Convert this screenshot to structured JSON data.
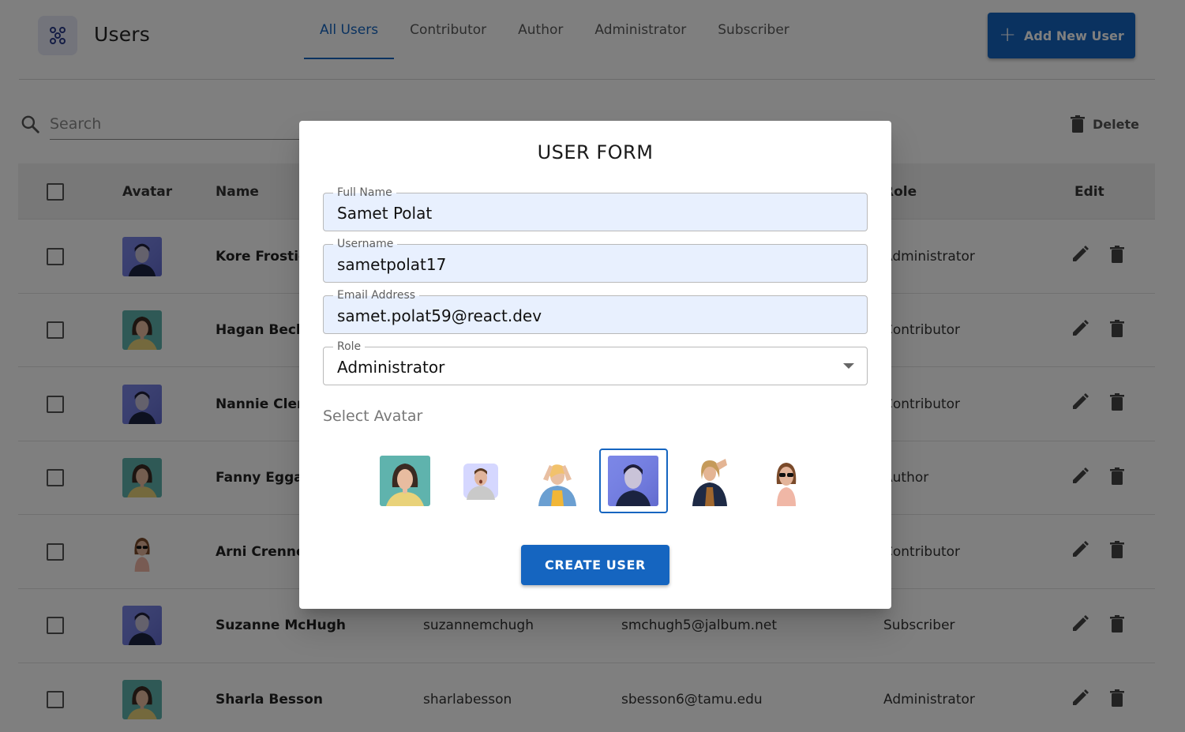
{
  "header": {
    "title": "Users",
    "tabs": [
      {
        "label": "All Users",
        "active": true
      },
      {
        "label": "Contributor",
        "active": false
      },
      {
        "label": "Author",
        "active": false
      },
      {
        "label": "Administrator",
        "active": false
      },
      {
        "label": "Subscriber",
        "active": false
      }
    ],
    "add_button": "Add New User"
  },
  "toolbar": {
    "search_placeholder": "Search",
    "delete_label": "Delete"
  },
  "table": {
    "columns": [
      "Avatar",
      "Name",
      "Role",
      "Edit"
    ],
    "rows": [
      {
        "avatar": "avatar-blue-portrait",
        "name": "Kore Frostic",
        "username": "",
        "email": "",
        "role": "Administrator"
      },
      {
        "avatar": "avatar-teal-woman",
        "name": "Hagan Beck",
        "username": "",
        "email": "",
        "role": "Contributor"
      },
      {
        "avatar": "avatar-blue-portrait",
        "name": "Nannie Cler",
        "username": "",
        "email": "",
        "role": "Contributor"
      },
      {
        "avatar": "avatar-teal-woman",
        "name": "Fanny Egga",
        "username": "",
        "email": "",
        "role": "Author"
      },
      {
        "avatar": "avatar-sunglasses-woman",
        "name": "Arni Crenne",
        "username": "",
        "email": "",
        "role": "Contributor"
      },
      {
        "avatar": "avatar-blue-portrait",
        "name": "Suzanne McHugh",
        "username": "suzannemchugh",
        "email": "smchugh5@jalbum.net",
        "role": "Subscriber"
      },
      {
        "avatar": "avatar-teal-woman",
        "name": "Sharla Besson",
        "username": "sharlabesson",
        "email": "sbesson6@tamu.edu",
        "role": "Administrator"
      }
    ]
  },
  "dialog": {
    "title": "USER FORM",
    "fields": {
      "full_name": {
        "label": "Full Name",
        "value": "Samet Polat"
      },
      "username": {
        "label": "Username",
        "value": "sametpolat17"
      },
      "email": {
        "label": "Email Address",
        "value": "samet.polat59@react.dev"
      },
      "role": {
        "label": "Role",
        "value": "Administrator"
      }
    },
    "avatar_label": "Select Avatar",
    "avatars": [
      "avatar-teal-woman",
      "avatar-hoodie-man",
      "avatar-yellow-jacket",
      "avatar-blue-portrait",
      "avatar-jacket-woman",
      "avatar-sunglasses-woman"
    ],
    "selected_avatar_index": 3,
    "create_button": "CREATE USER"
  },
  "colors": {
    "primary": "#1565c0",
    "backdrop": "rgba(0,0,0,0.5)",
    "autofill": "#e8f0fe"
  }
}
